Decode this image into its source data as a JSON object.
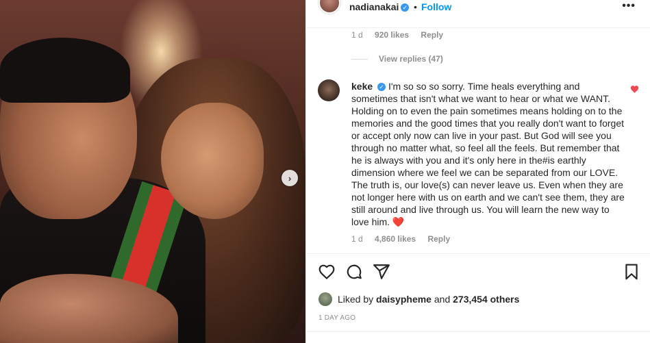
{
  "post": {
    "username": "nadianakai",
    "dot": "•",
    "follow_label": "Follow",
    "more_label": "•••"
  },
  "prev_comment": {
    "age": "1 d",
    "likes": "920 likes",
    "reply_label": "Reply",
    "view_replies": "View replies (47)"
  },
  "comment": {
    "username": "keke",
    "text": "I'm so so so sorry. Time heals everything and sometimes that isn't what we want to hear or what we WANT. Holding on to even the pain sometimes means holding on to the memories and the good times that you really don't want to forget or accept only now can live in your past. But God will see you through no matter what, so feel all the feels. But remember that he is always with you and it's only here in the#is earthly dimension where we feel we can be separated from our LOVE. The truth is, our love(s) can never leave us. Even when they are not longer here with us on earth and we can't see them, they are still around and live through us. You will learn the new way to love him.",
    "emoji": "❤️",
    "age": "1 d",
    "likes": "4,860 likes",
    "reply_label": "Reply"
  },
  "likes_summary": {
    "prefix": "Liked by",
    "user": "daisypheme",
    "middle": "and",
    "count": "273,454 others"
  },
  "timestamp": "1 DAY AGO",
  "colors": {
    "link_blue": "#0095f6",
    "heart_red": "#ed4956",
    "muted": "#8e8e8e"
  },
  "icons": [
    "heart-icon",
    "comment-icon",
    "share-icon",
    "bookmark-icon",
    "chevron-right-icon",
    "verified-icon"
  ]
}
